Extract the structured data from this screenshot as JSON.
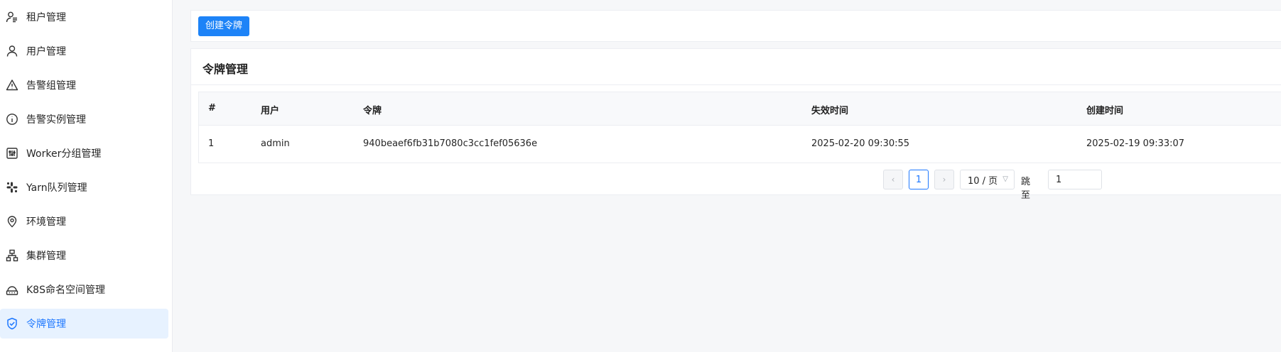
{
  "sidebar": {
    "items": [
      {
        "label": "租户管理",
        "icon": "tenant-icon"
      },
      {
        "label": "用户管理",
        "icon": "user-icon"
      },
      {
        "label": "告警组管理",
        "icon": "warning-icon"
      },
      {
        "label": "告警实例管理",
        "icon": "info-icon"
      },
      {
        "label": "Worker分组管理",
        "icon": "worker-group-icon"
      },
      {
        "label": "Yarn队列管理",
        "icon": "yarn-queue-icon"
      },
      {
        "label": "环境管理",
        "icon": "location-pin-icon"
      },
      {
        "label": "集群管理",
        "icon": "cluster-icon"
      },
      {
        "label": "K8S命名空间管理",
        "icon": "k8s-namespace-icon"
      },
      {
        "label": "令牌管理",
        "icon": "shield-check-icon",
        "active": true
      }
    ]
  },
  "toolbar": {
    "create_label": "创建令牌"
  },
  "card": {
    "title": "令牌管理"
  },
  "table": {
    "columns": [
      "#",
      "用户",
      "令牌",
      "失效时间",
      "创建时间"
    ],
    "rows": [
      [
        "1",
        "admin",
        "940beaef6fb31b7080c3cc1fef05636e",
        "2025-02-20 09:30:55",
        "2025-02-19 09:33:07"
      ]
    ]
  },
  "pagination": {
    "current_page": "1",
    "page_size": "10 / 页",
    "jump_label": "跳至",
    "jump_value": "1"
  },
  "colors": {
    "accent": "#1e78ff",
    "button": "#1d83f7",
    "active_bg": "#e7f2ff",
    "page_bg": "#f6f7f9"
  }
}
